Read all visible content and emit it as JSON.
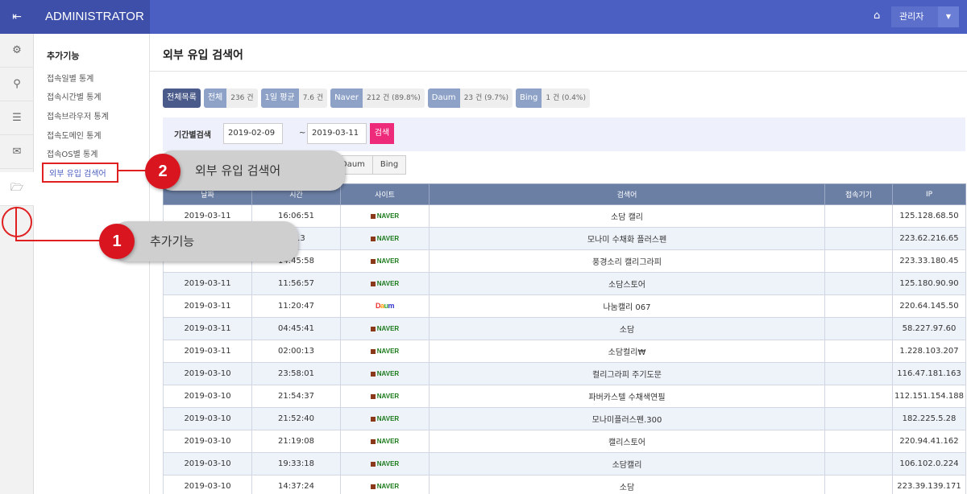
{
  "header": {
    "menu_icon": "menu-collapse-icon",
    "title": "ADMINISTRATOR",
    "home_icon": "home-icon",
    "user_label": "관리자",
    "caret_icon": "caret-down-icon"
  },
  "rail": {
    "items": [
      {
        "icon": "gear-icon",
        "glyph": "⚙"
      },
      {
        "icon": "user-icon",
        "glyph": "⚲"
      },
      {
        "icon": "list-icon",
        "glyph": "☰"
      },
      {
        "icon": "mail-icon",
        "glyph": "✉"
      },
      {
        "icon": "folder-open-icon",
        "glyph": "🗁"
      }
    ]
  },
  "sidemenu": {
    "title": "추가기능",
    "items": [
      {
        "label": "접속일별 통계"
      },
      {
        "label": "접속시간별 통계"
      },
      {
        "label": "접속브라우저 통계"
      },
      {
        "label": "접속도메인 통계"
      },
      {
        "label": "접속OS별 통계"
      },
      {
        "label": "외부 유입 검색어"
      }
    ]
  },
  "page": {
    "title": "외부 유입 검색어"
  },
  "stats": [
    {
      "key": "전체목록",
      "value": ""
    },
    {
      "key": "전체",
      "value": "236 건"
    },
    {
      "key": "1일 평균",
      "value": "7.6 건"
    },
    {
      "key": "Naver",
      "value": "212 건 (89.8%)"
    },
    {
      "key": "Daum",
      "value": "23 건 (9.7%)"
    },
    {
      "key": "Bing",
      "value": "1 건 (0.4%)"
    }
  ],
  "search": {
    "label": "기간별검색",
    "from": "2019-02-09",
    "tilde": "~",
    "to": "2019-03-11",
    "button": "검색"
  },
  "tabs": [
    "Daum",
    "Bing"
  ],
  "table": {
    "headers": [
      "날짜",
      "시간",
      "사이트",
      "검색어",
      "접속기기",
      "IP"
    ],
    "rows": [
      {
        "date": "2019-03-11",
        "time": "16:06:51",
        "site": "NAVER",
        "keyword": "소담 캘리",
        "device": "",
        "ip": "125.128.68.50"
      },
      {
        "date": "",
        "time": "6:13",
        "site": "NAVER",
        "keyword": "모나미 수채화 플러스펜",
        "device": "",
        "ip": "223.62.216.65"
      },
      {
        "date": "",
        "time": "14:45:58",
        "site": "NAVER",
        "keyword": "풍경소리 캘리그라피",
        "device": "",
        "ip": "223.33.180.45"
      },
      {
        "date": "2019-03-11",
        "time": "11:56:57",
        "site": "NAVER",
        "keyword": "소담스토어",
        "device": "",
        "ip": "125.180.90.90"
      },
      {
        "date": "2019-03-11",
        "time": "11:20:47",
        "site": "Daum",
        "keyword": "나눔캘리 067",
        "device": "",
        "ip": "220.64.145.50"
      },
      {
        "date": "2019-03-11",
        "time": "04:45:41",
        "site": "NAVER",
        "keyword": "소담",
        "device": "",
        "ip": "58.227.97.60"
      },
      {
        "date": "2019-03-11",
        "time": "02:00:13",
        "site": "NAVER",
        "keyword": "소담컬리₩",
        "device": "",
        "ip": "1.228.103.207"
      },
      {
        "date": "2019-03-10",
        "time": "23:58:01",
        "site": "NAVER",
        "keyword": "컬리그라피 주기도문",
        "device": "",
        "ip": "116.47.181.163"
      },
      {
        "date": "2019-03-10",
        "time": "21:54:37",
        "site": "NAVER",
        "keyword": "파버카스텔 수채색연필",
        "device": "",
        "ip": "112.151.154.188"
      },
      {
        "date": "2019-03-10",
        "time": "21:52:40",
        "site": "NAVER",
        "keyword": "모나미플러스펜.300",
        "device": "",
        "ip": "182.225.5.28"
      },
      {
        "date": "2019-03-10",
        "time": "21:19:08",
        "site": "NAVER",
        "keyword": "캘리스토어",
        "device": "",
        "ip": "220.94.41.162"
      },
      {
        "date": "2019-03-10",
        "time": "19:33:18",
        "site": "NAVER",
        "keyword": "소담캘리",
        "device": "",
        "ip": "106.102.0.224"
      },
      {
        "date": "2019-03-10",
        "time": "14:37:24",
        "site": "NAVER",
        "keyword": "소담",
        "device": "",
        "ip": "223.39.139.171"
      }
    ]
  },
  "callouts": [
    {
      "num": "1",
      "text": "추가기능"
    },
    {
      "num": "2",
      "text": "외부 유입 검색어"
    }
  ],
  "colors": {
    "topbar": "#4a5fc1",
    "accent_button": "#ee2a7b",
    "table_header": "#6b7fa5",
    "callout_red": "#d9161f"
  }
}
